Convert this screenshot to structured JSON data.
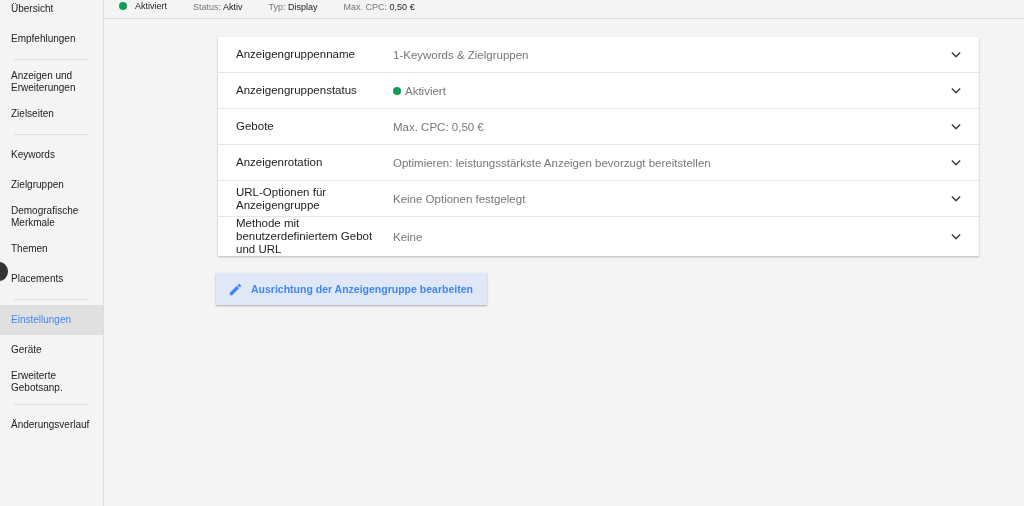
{
  "header": {
    "status_label": "Aktiviert",
    "active": true,
    "facts": [
      "Status: **Aktiv**",
      "Typ: **Display**",
      "Max. CPC: **0,50 €**"
    ]
  },
  "sidebar": {
    "groups": [
      {
        "items": [
          {
            "label": "Übersicht",
            "selected": false
          },
          {
            "label": "Empfehlungen",
            "selected": false
          }
        ]
      },
      {
        "items": [
          {
            "label": "Anzeigen und Erweiterungen",
            "selected": false
          },
          {
            "label": "Zielseiten",
            "selected": false
          }
        ]
      },
      {
        "items": [
          {
            "label": "Keywords",
            "selected": false
          },
          {
            "label": "Zielgruppen",
            "selected": false
          },
          {
            "label": "Demografische Merkmale",
            "selected": false
          },
          {
            "label": "Themen",
            "selected": false
          },
          {
            "label": "Placements",
            "selected": false
          }
        ]
      },
      {
        "items": [
          {
            "label": "Einstellungen",
            "selected": true
          },
          {
            "label": "Geräte",
            "selected": false
          },
          {
            "label": "Erweiterte Gebotsanp.",
            "selected": false
          }
        ]
      },
      {
        "items": [
          {
            "label": "Änderungsverlauf",
            "selected": false
          }
        ]
      }
    ]
  },
  "settings": [
    {
      "label": "Anzeigengruppenname",
      "value": "1-Keywords & Zielgruppen"
    },
    {
      "label": "Anzeigengruppenstatus",
      "value": "Aktiviert",
      "color": "#0f9d58"
    },
    {
      "label": "Gebote",
      "value": "Max. CPC: 0,50 €"
    },
    {
      "label": "Anzeigenrotation",
      "value": "Optimieren: leistungsstärkste Anzeigen bevorzugt bereitstellen"
    },
    {
      "label": "URL-Optionen für Anzeigengruppe",
      "value": "Keine Optionen festgelegt"
    },
    {
      "label": "Methode mit benutzerdefiniertem Gebot und URL",
      "value": "Keine"
    }
  ],
  "edit_button": "Ausrichtung der Anzeigengruppe bearbeiten"
}
